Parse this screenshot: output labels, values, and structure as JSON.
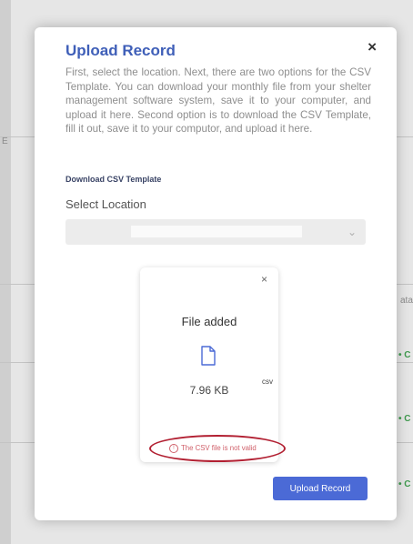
{
  "modal": {
    "title": "Upload Record",
    "close_glyph": "×",
    "description": "First, select the location. Next, there are two options for the CSV Template. You can download your monthly file from your shelter management software system, save it to your computer, and upload it here. Second option is to download the CSV Template, fill it out, save it to your computor, and upload it here.",
    "download_link": "Download CSV Template",
    "select_label": "Select Location",
    "select_value": "",
    "select_chevron": "⌄",
    "file": {
      "remove_glyph": "×",
      "status": "File added",
      "size": "7.96 KB",
      "extension": "csv",
      "error": "The CSV file is not valid",
      "error_icon": "!"
    },
    "upload_button": "Upload Record"
  },
  "background": {
    "col_header_fragment": "ata",
    "row_marker": "• C",
    "left_fragment": "E"
  },
  "colors": {
    "title": "#3f5fb8",
    "button": "#4b6ad6",
    "error": "#d0606a",
    "highlight": "#b22032"
  },
  "icons": [
    "close-icon",
    "document-icon",
    "chevron-down-icon",
    "alert-circle-icon"
  ]
}
